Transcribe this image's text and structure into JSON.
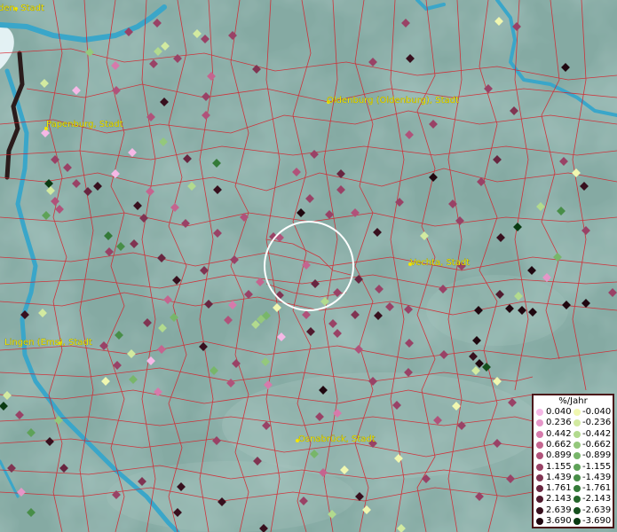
{
  "cities": [
    {
      "name": "Papenburg, Stadt"
    },
    {
      "name": "Oldenburg (Oldenburg), Stadt"
    },
    {
      "name": "Vechta, Stadt"
    },
    {
      "name": "Lingen (Ems), Stadt"
    },
    {
      "name": "Osnabrück, Stadt"
    },
    {
      "name": "den, Stadt"
    }
  ],
  "legend": {
    "title": "%/Jahr",
    "rows": [
      {
        "pos": "0.040",
        "neg": "-0.040",
        "pos_color": "#f5b8e6",
        "neg_color": "#f0f7b0"
      },
      {
        "pos": "0.236",
        "neg": "-0.236",
        "pos_color": "#e596c8",
        "neg_color": "#d2eaa0"
      },
      {
        "pos": "0.442",
        "neg": "-0.442",
        "pos_color": "#d67aab",
        "neg_color": "#b2da8e"
      },
      {
        "pos": "0.662",
        "neg": "-0.662",
        "pos_color": "#c4658f",
        "neg_color": "#94c87c"
      },
      {
        "pos": "0.899",
        "neg": "-0.899",
        "pos_color": "#b0527a",
        "neg_color": "#78b66a"
      },
      {
        "pos": "1.155",
        "neg": "-1.155",
        "pos_color": "#994266",
        "neg_color": "#5ea258"
      },
      {
        "pos": "1.439",
        "neg": "-1.439",
        "pos_color": "#803452",
        "neg_color": "#488e48"
      },
      {
        "pos": "1.761",
        "neg": "-1.761",
        "pos_color": "#682640",
        "neg_color": "#347a38"
      },
      {
        "pos": "2.143",
        "neg": "-2.143",
        "pos_color": "#501a2e",
        "neg_color": "#24662a"
      },
      {
        "pos": "2.639",
        "neg": "-2.639",
        "pos_color": "#38101e",
        "neg_color": "#16501e"
      },
      {
        "pos": "3.690",
        "neg": "-3.690",
        "pos_color": "#200810",
        "neg_color": "#0a3a12"
      }
    ]
  }
}
